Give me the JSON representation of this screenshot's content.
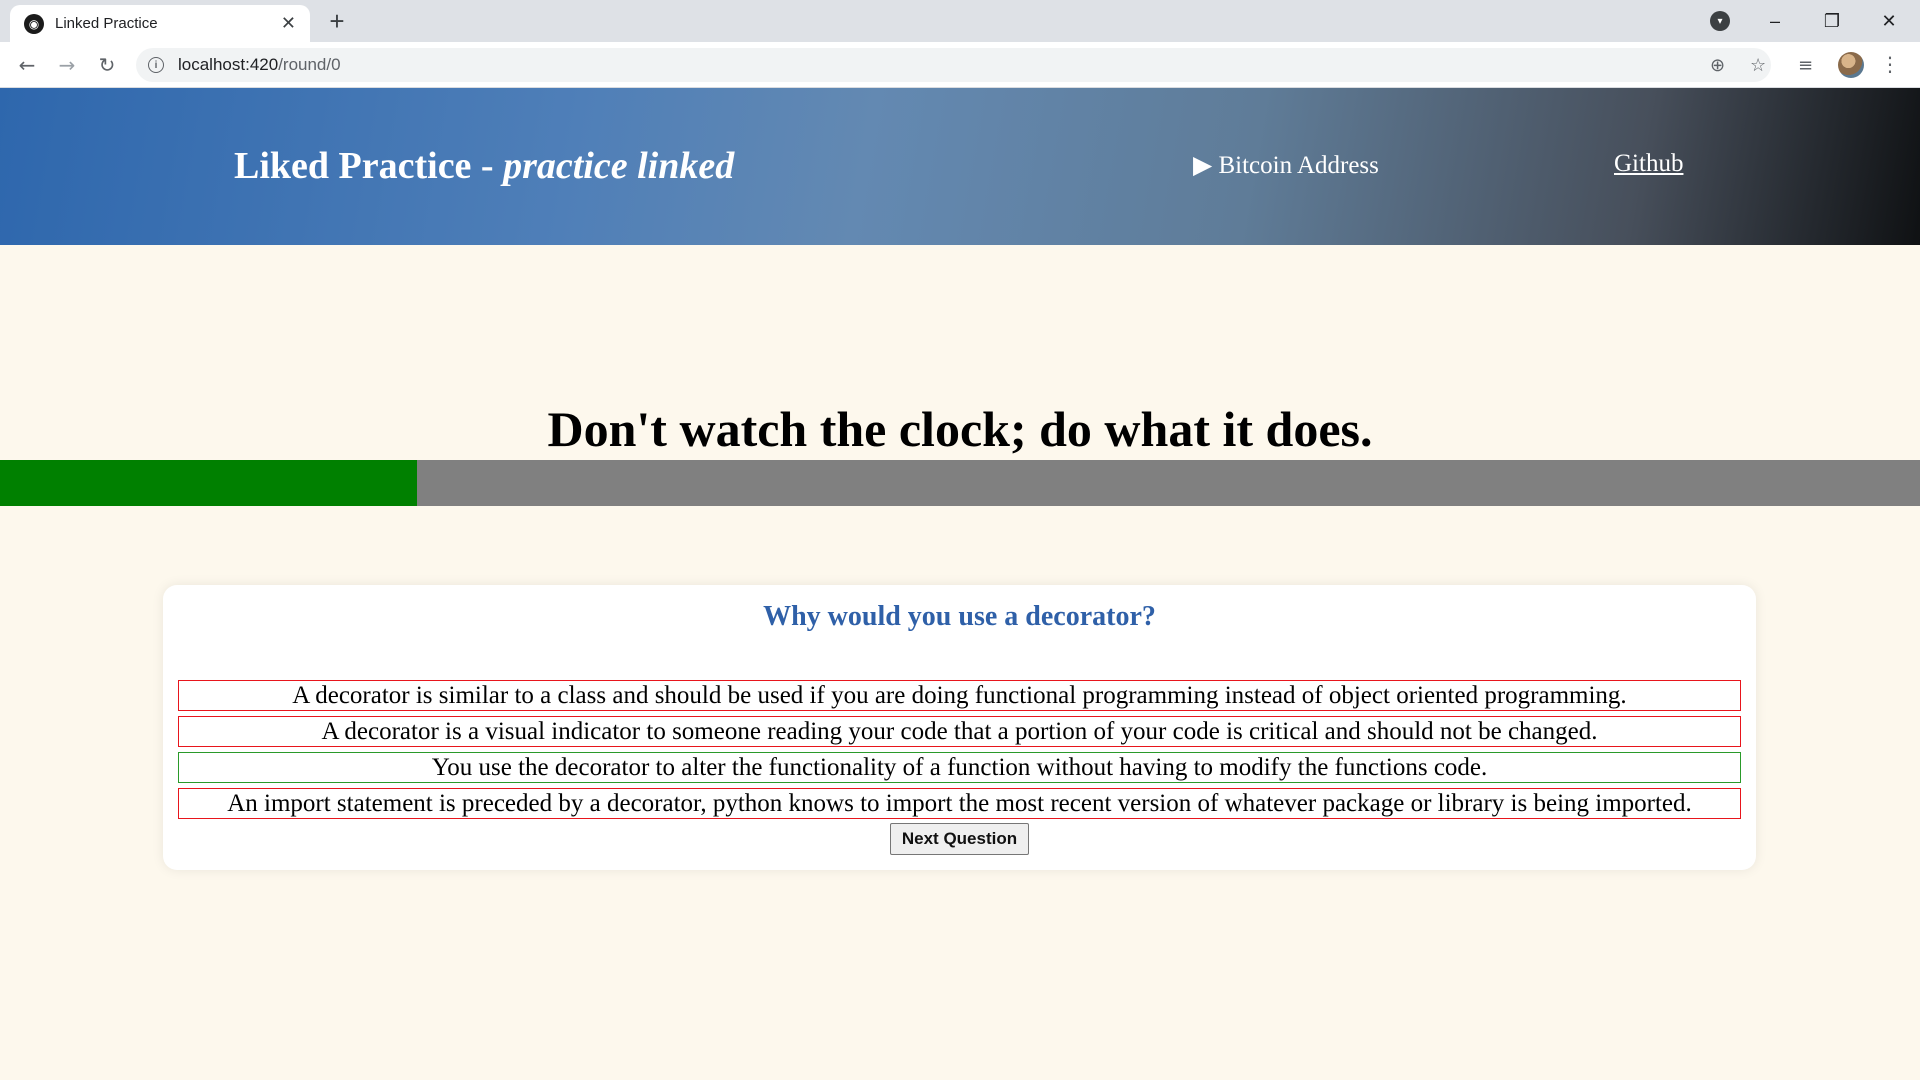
{
  "browser": {
    "tab_title": "Linked Practice",
    "tab_close": "✕",
    "new_tab": "+",
    "url_host": "localhost:420",
    "url_path": "/round/0",
    "window": {
      "minimize": "–",
      "restore": "❐",
      "close": "✕"
    }
  },
  "header": {
    "brand_main": "Liked Practice - ",
    "brand_italic": "practice linked",
    "bitcoin_label": "▶ Bitcoin Address",
    "github_label": "Github"
  },
  "quote": "Don't watch the clock; do what it does.",
  "progress": {
    "fraction": 0.217,
    "fill_color": "#008000",
    "track_color": "#808080"
  },
  "question": {
    "text": "Why would you use a decorator?",
    "answers": [
      {
        "text": "A decorator is similar to a class and should be used if you are doing functional programming instead of object oriented programming.",
        "status": "wrong"
      },
      {
        "text": "A decorator is a visual indicator to someone reading your code that a portion of your code is critical and should not be changed.",
        "status": "wrong"
      },
      {
        "text": "You use the decorator to alter the functionality of a function without having to modify the functions code.",
        "status": "right"
      },
      {
        "text": "An import statement is preceded by a decorator, python knows to import the most recent version of whatever package or library is being imported.",
        "status": "wrong"
      }
    ],
    "next_button": "Next Question"
  },
  "colors": {
    "accent": "#2f60a8",
    "wrong_border": "#e8151c",
    "right_border": "#2a9a2a",
    "page_bg": "#fdf8ed"
  }
}
